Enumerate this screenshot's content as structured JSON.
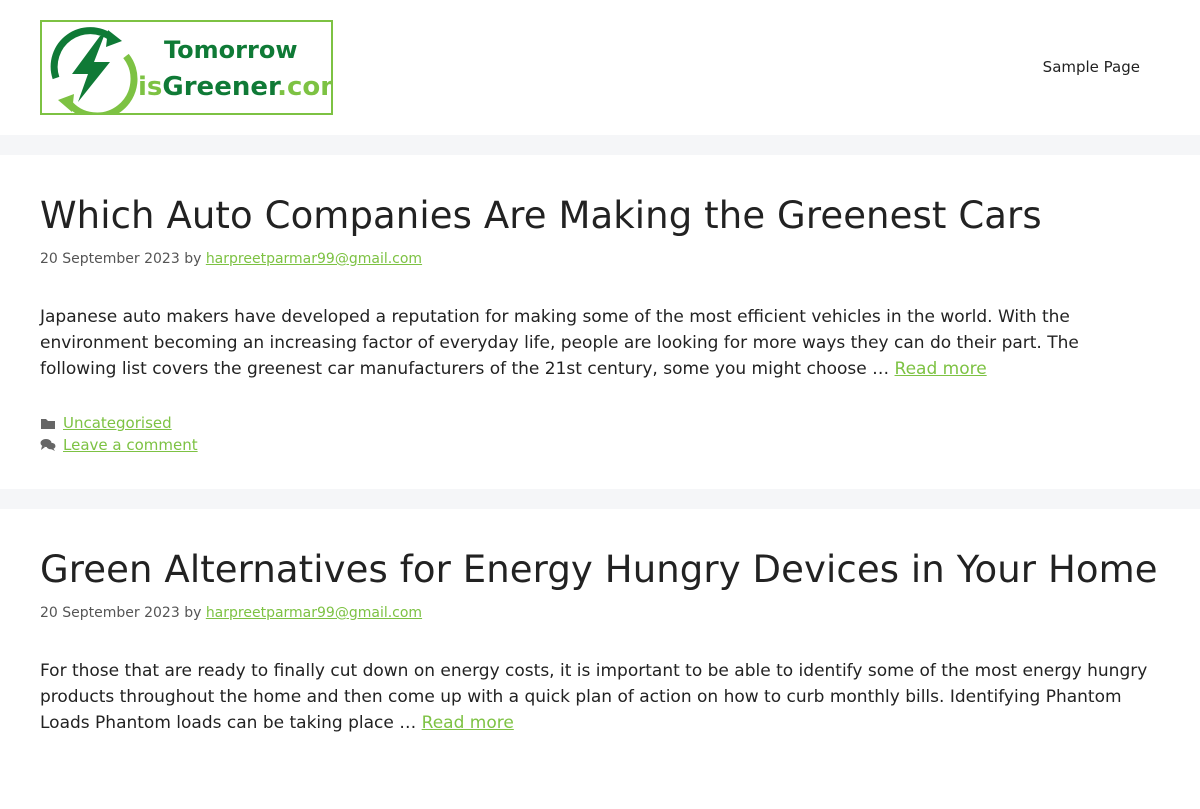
{
  "header": {
    "logo_line1": "Tomorrow",
    "logo_line2_a": "is",
    "logo_line2_b": "Greener",
    "logo_line2_c": ".com",
    "nav_item": "Sample Page"
  },
  "colors": {
    "accent": "#7dc243",
    "logo_dark_green": "#0f7a36",
    "background": "#f5f6f8"
  },
  "posts": [
    {
      "title": "Which Auto Companies Are Making the Greenest Cars",
      "date": "20 September 2023",
      "by": "by",
      "author": "harpreetparmar99@gmail.com",
      "summary": "Japanese auto makers have developed a reputation for making some of the most efficient vehicles in the world. With the environment becoming an increasing factor of everyday life, people are looking for more ways they can do their part. The following list covers the greenest car manufacturers of the 21st century, some you might choose … ",
      "read_more": "Read more",
      "category": "Uncategorised",
      "comment": "Leave a comment"
    },
    {
      "title": "Green Alternatives for Energy Hungry Devices in Your Home",
      "date": "20 September 2023",
      "by": "by",
      "author": "harpreetparmar99@gmail.com",
      "summary": "For those that are ready to finally cut down on energy costs, it is important to be able to identify some of the most energy hungry products throughout the home and then come up with a quick plan of action on how to curb monthly bills. Identifying Phantom Loads Phantom loads can be taking place … ",
      "read_more": "Read more"
    }
  ],
  "icons": [
    "logo-bolt-icon",
    "folder-icon",
    "comments-icon"
  ]
}
